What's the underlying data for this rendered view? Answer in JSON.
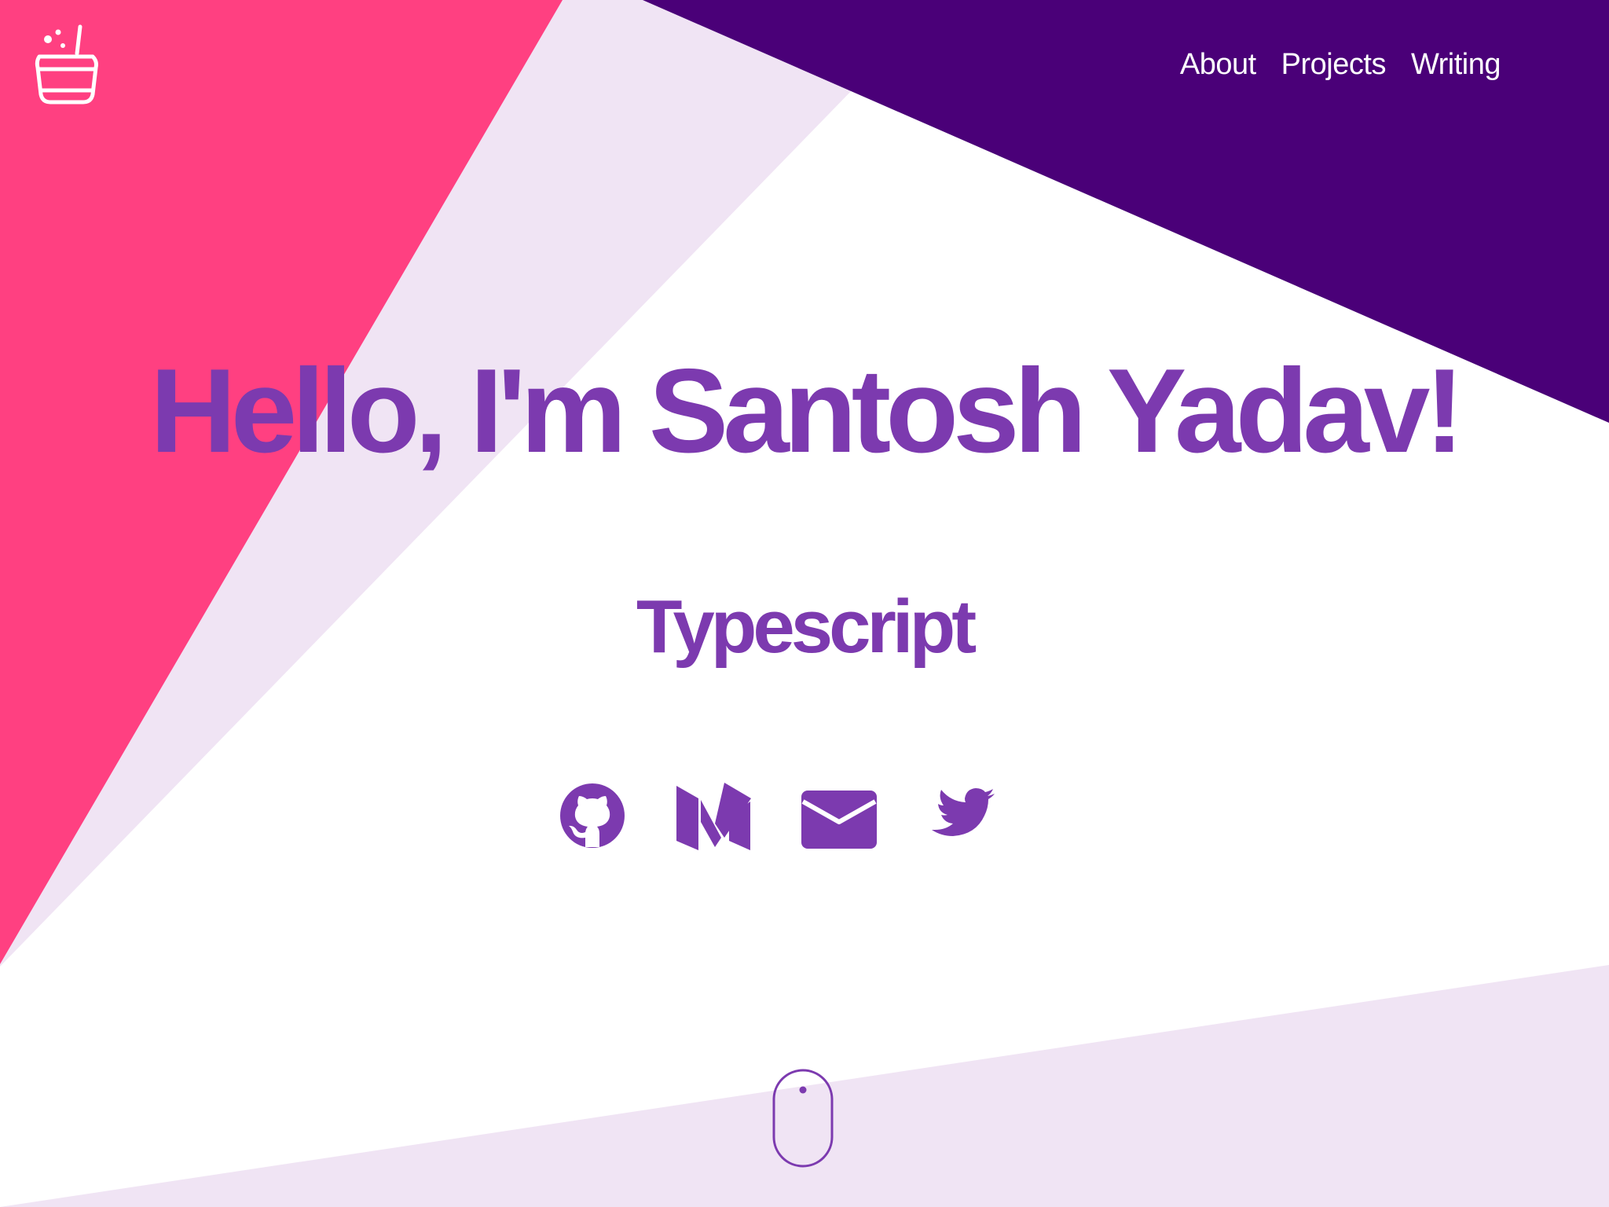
{
  "header": {
    "nav": [
      {
        "label": "About"
      },
      {
        "label": "Projects"
      },
      {
        "label": "Writing"
      }
    ]
  },
  "hero": {
    "title": "Hello, I'm Santosh Yadav!",
    "subtitle": "Typescript"
  },
  "social_links": [
    {
      "icon": "github-icon"
    },
    {
      "icon": "medium-icon"
    },
    {
      "icon": "mail-icon"
    },
    {
      "icon": "twitter-icon"
    }
  ],
  "colors": {
    "brand_purple": "#7c3aaf",
    "dark_purple": "#4a0078",
    "pink": "#ff4081",
    "lavender": "#f0e4f4",
    "background": "#ffffff"
  }
}
